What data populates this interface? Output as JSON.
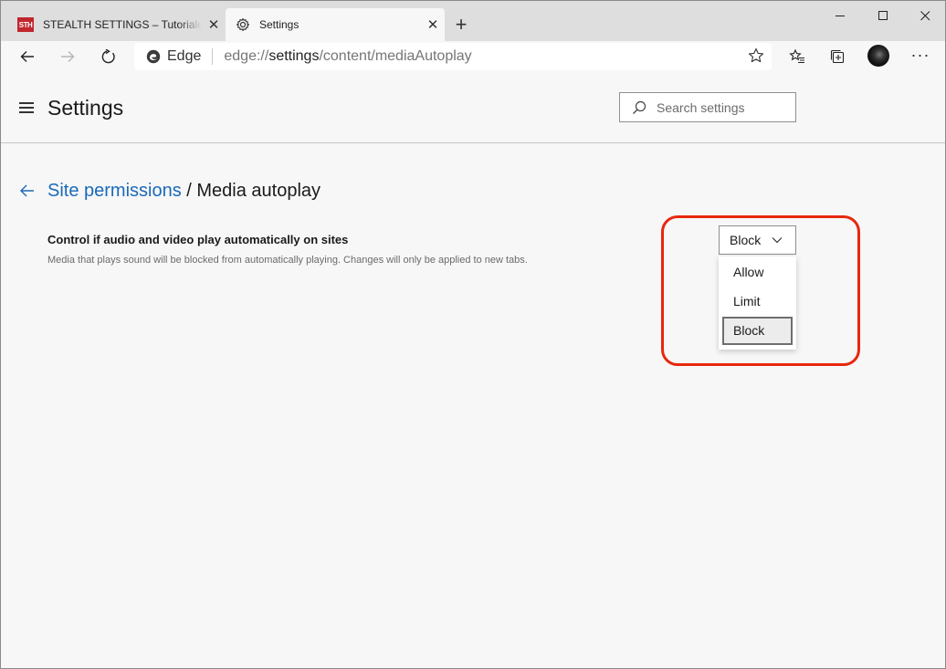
{
  "tabs": {
    "inactive": {
      "favicon_text": "STH",
      "title": "STEALTH SETTINGS – Tutoriale, Ajutor"
    },
    "active": {
      "title": "Settings"
    },
    "close_glyph": "✕",
    "new_tab_glyph": "+"
  },
  "window_controls": {
    "minimize": "minimize-icon",
    "maximize": "maximize-icon",
    "close": "close-icon"
  },
  "address_bar": {
    "site_label": "Edge",
    "url_prefix": "edge://",
    "url_host": "settings",
    "url_path": "/content/mediaAutoplay"
  },
  "toolbar": {
    "more_glyph": "···"
  },
  "header": {
    "title": "Settings",
    "search_placeholder": "Search settings"
  },
  "breadcrumb": {
    "parent": "Site permissions",
    "separator": " / ",
    "current": "Media autoplay"
  },
  "setting": {
    "label": "Control if audio and video play automatically on sites",
    "description": "Media that plays sound will be blocked from automatically playing. Changes will only be applied to new tabs.",
    "selected": "Block",
    "options": [
      "Allow",
      "Limit",
      "Block"
    ]
  },
  "colors": {
    "link": "#1a6ab8",
    "highlight": "#e8270e",
    "tab_favicon": "#c1272d"
  }
}
